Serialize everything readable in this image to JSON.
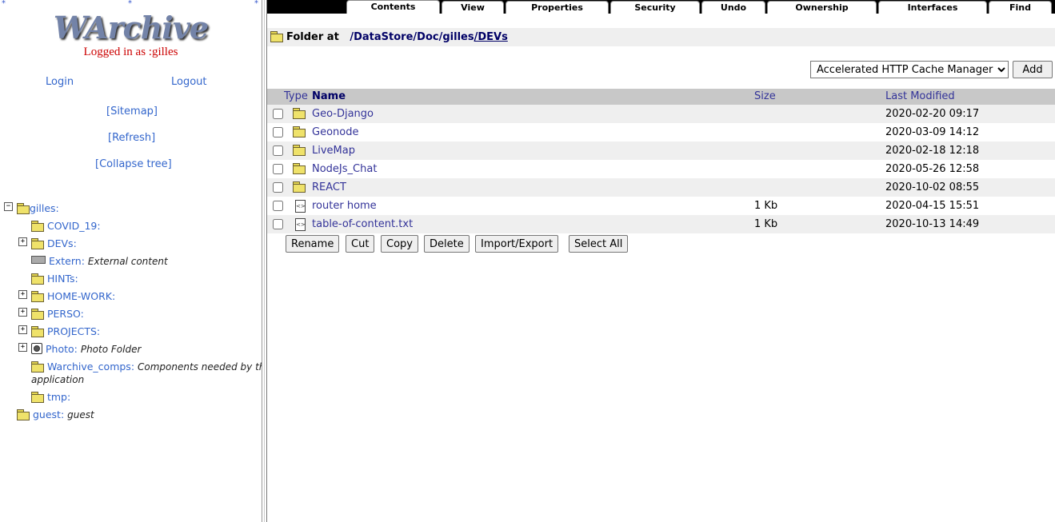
{
  "left": {
    "logo": "WArchive",
    "logged_in": "Logged in as :gilles",
    "login": "Login",
    "logout": "Logout",
    "sitemap": "[Sitemap]",
    "refresh": "[Refresh]",
    "collapse": "[Collapse tree]",
    "tree": {
      "root": {
        "name": "gilles:",
        "expander": "−"
      },
      "children": [
        {
          "name": "COVID_19:",
          "desc": ""
        },
        {
          "name": "DEVs:",
          "desc": "",
          "expander": "+"
        },
        {
          "name": "Extern:",
          "desc": "External content"
        },
        {
          "name": "HINTs:",
          "desc": ""
        },
        {
          "name": "HOME-WORK:",
          "desc": "",
          "expander": "+"
        },
        {
          "name": "PERSO:",
          "desc": "",
          "expander": "+"
        },
        {
          "name": "PROJECTS:",
          "desc": "",
          "expander": "+"
        },
        {
          "name": "Photo:",
          "desc": "Photo Folder",
          "expander": "+"
        },
        {
          "name": "Warchive_comps:",
          "desc": "Components needed by this",
          "desc2": "application"
        },
        {
          "name": "tmp:",
          "desc": ""
        }
      ],
      "guest": {
        "name": "guest:",
        "desc": "guest"
      }
    }
  },
  "tabs": [
    "Contents",
    "View",
    "Properties",
    "Security",
    "Undo",
    "Ownership",
    "Interfaces",
    "Find"
  ],
  "breadcrumb": {
    "prefix": "Folder at",
    "parts": [
      "/DataStore",
      "/Doc",
      "/gilles",
      "/DEVs"
    ]
  },
  "add": {
    "selected": "Accelerated HTTP Cache Manager",
    "button": "Add"
  },
  "table": {
    "headers": {
      "type": "Type",
      "name": "Name",
      "size": "Size",
      "modified": "Last Modified"
    },
    "rows": [
      {
        "icon": "folder-icon",
        "name": "Geo-Django",
        "size": "",
        "modified": "2020-02-20 09:17"
      },
      {
        "icon": "folder-icon",
        "name": "Geonode",
        "size": "",
        "modified": "2020-03-09 14:12"
      },
      {
        "icon": "folder-icon",
        "name": "LiveMap",
        "size": "",
        "modified": "2020-02-18 12:18"
      },
      {
        "icon": "folder-icon",
        "name": "NodeJs_Chat",
        "size": "",
        "modified": "2020-05-26 12:58"
      },
      {
        "icon": "folder-icon",
        "name": "REACT",
        "size": "",
        "modified": "2020-10-02 08:55"
      },
      {
        "icon": "file-icon",
        "name": "router home",
        "size": "1 Kb",
        "modified": "2020-04-15 15:51"
      },
      {
        "icon": "file-icon",
        "name": "table-of-content.txt",
        "size": "1 Kb",
        "modified": "2020-10-13 14:49"
      }
    ]
  },
  "actions": [
    "Rename",
    "Cut",
    "Copy",
    "Delete",
    "Import/Export",
    "Select All"
  ]
}
